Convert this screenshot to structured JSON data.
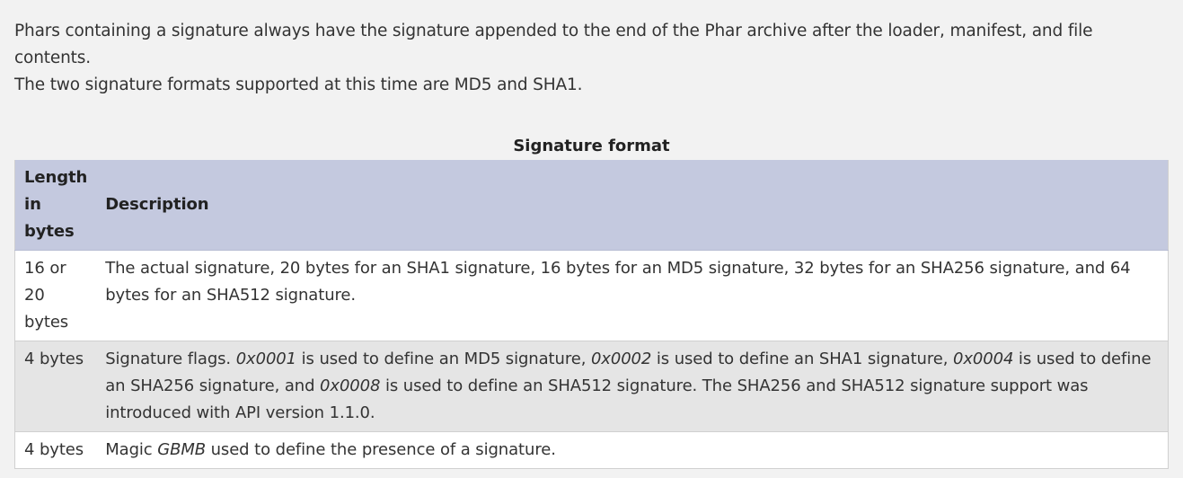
{
  "intro": {
    "line1": "Phars containing a signature always have the signature appended to the end of the Phar archive after the loader, manifest, and file contents.",
    "line2": "The two signature formats supported at this time are MD5 and SHA1."
  },
  "table": {
    "caption": "Signature format",
    "headers": [
      "Length in bytes",
      "Description"
    ],
    "rows": [
      {
        "length": "16 or 20 bytes",
        "description": "The actual signature, 20 bytes for an SHA1 signature, 16 bytes for an MD5 signature, 32 bytes for an SHA256 signature, and 64 bytes for an SHA512 signature."
      },
      {
        "length": "4 bytes",
        "d1": "Signature flags. ",
        "flag1": "0x0001",
        "d2": " is used to define an MD5 signature, ",
        "flag2": "0x0002",
        "d3": " is used to define an SHA1 signature, ",
        "flag3": "0x0004",
        "d4": " is used to define an SHA256 signature, and ",
        "flag4": "0x0008",
        "d5": " is used to define an SHA512 signature. The SHA256 and SHA512 signature support was introduced with API version 1.1.0."
      },
      {
        "length": "4 bytes",
        "d1": "Magic ",
        "magic": "GBMB",
        "d2": " used to define the presence of a signature."
      }
    ]
  },
  "colors": {
    "header_bg": "#c4c9df",
    "page_bg": "#f2f2f2",
    "row_alt_bg": "#e5e5e5"
  }
}
